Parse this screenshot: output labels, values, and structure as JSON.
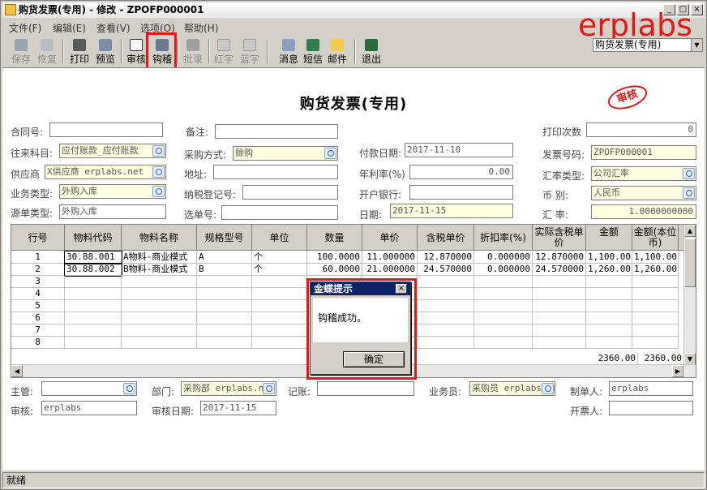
{
  "window": {
    "title": "购货发票(专用) - 修改 - ZPOFP000001",
    "btn_min": "_",
    "btn_max": "□",
    "btn_close": "×"
  },
  "brand": "erplabs",
  "menu": [
    "文件(F)",
    "编辑(E)",
    "查看(V)",
    "选项(O)",
    "帮助(H)"
  ],
  "toolbar": {
    "save": "保存",
    "restore": "恢复",
    "print": "打印",
    "preview": "预览",
    "audit": "审核",
    "reconcile": "钩稽",
    "batch": "批录",
    "red": "红字",
    "blue": "蓝字",
    "message": "消息",
    "sms": "短信",
    "mail": "邮件",
    "exit": "退出",
    "doc_type": "购货发票(专用)"
  },
  "doc": {
    "heading": "购货发票(专用)",
    "stamp": "审核"
  },
  "header": {
    "contract_label": "合同号:",
    "contract": "",
    "remark_label": "备注:",
    "remark": "",
    "print_count_label": "打印次数",
    "print_count": "0",
    "account_label": "往来科目:",
    "account": "应付账款_应付账款",
    "purchase_method_label": "采购方式:",
    "purchase_method": "赊购",
    "payment_date_label": "付款日期:",
    "payment_date": "2017-11-10",
    "invoice_no_label": "发票号码:",
    "invoice_no": "ZPOFP000001",
    "supplier_label": "供应商",
    "supplier": "X供应商 erplabs.net",
    "address_label": "地址:",
    "address": "",
    "annual_rate_label": "年利率(%)",
    "annual_rate": "0.00",
    "rate_type_label": "汇率类型:",
    "rate_type": "公司汇率",
    "business_type_label": "业务类型:",
    "business_type": "外购入库",
    "tax_reg_label": "纳税登记号:",
    "tax_reg": "",
    "bank_label": "开户银行:",
    "bank": "",
    "currency_label": "币  别:",
    "currency": "人民币",
    "source_type_label": "源单类型:",
    "source_type": "外购入库",
    "select_no_label": "选单号:",
    "select_no": "",
    "date_label": "日期:",
    "date": "2017-11-15",
    "exchange_label": "汇  率:",
    "exchange": "1.0000000000"
  },
  "grid": {
    "columns": [
      "行号",
      "物料代码",
      "物料名称",
      "规格型号",
      "单位",
      "数量",
      "单价",
      "含税单价",
      "折扣率(%)",
      "实际含税单价",
      "金额",
      "金额(本位币)"
    ],
    "rows": [
      [
        "1",
        "30.88.001",
        "A物料-商业模式",
        "A",
        "个",
        "100.0000",
        "11.000000",
        "12.870000",
        "0.000000",
        "12.870000",
        "1,100.00",
        "1,100.00"
      ],
      [
        "2",
        "30.88.002",
        "B物料-商业模式",
        "B",
        "个",
        "60.0000",
        "21.000000",
        "24.570000",
        "0.000000",
        "24.570000",
        "1,260.00",
        "1,260.00"
      ],
      [
        "3",
        "",
        "",
        "",
        "",
        "",
        "",
        "",
        "",
        "",
        "",
        ""
      ],
      [
        "4",
        "",
        "",
        "",
        "",
        "",
        "",
        "",
        "",
        "",
        "",
        ""
      ],
      [
        "5",
        "",
        "",
        "",
        "",
        "",
        "",
        "",
        "",
        "",
        "",
        ""
      ],
      [
        "6",
        "",
        "",
        "",
        "",
        "",
        "",
        "",
        "",
        "",
        "",
        ""
      ],
      [
        "7",
        "",
        "",
        "",
        "",
        "",
        "",
        "",
        "",
        "",
        "",
        ""
      ],
      [
        "8",
        "",
        "",
        "",
        "",
        "",
        "",
        "",
        "",
        "",
        "",
        ""
      ]
    ],
    "total_amount": "2360.00",
    "total_amount_base": "2360.00"
  },
  "footer": {
    "manager_label": "主管:",
    "manager": "",
    "dept_label": "部门:",
    "dept": "采购部 erplabs.net",
    "bookkeeper_label": "记账:",
    "bookkeeper": "",
    "clerk_label": "业务员:",
    "clerk": "采购员 erplabs.net",
    "maker_label": "制单人:",
    "maker": "erplabs",
    "auditor_label": "审核:",
    "auditor": "erplabs",
    "audit_date_label": "审核日期:",
    "audit_date": "2017-11-15",
    "issuer_label": "开票人:",
    "issuer": ""
  },
  "dialog": {
    "title": "金蝶提示",
    "message": "钩稽成功。",
    "ok": "确定"
  },
  "status": "就绪"
}
